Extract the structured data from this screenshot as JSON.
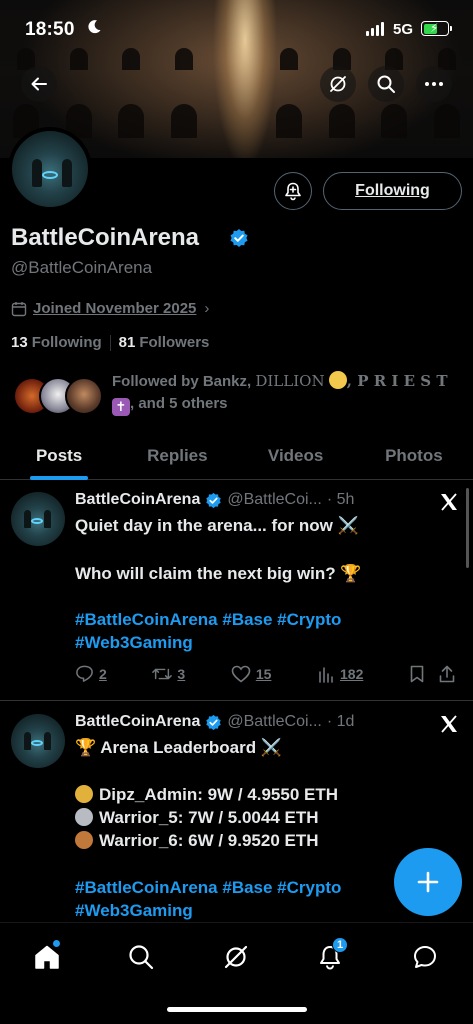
{
  "status_bar": {
    "time": "18:50",
    "network": "5G"
  },
  "profile": {
    "name": "BattleCoinArena",
    "handle": "@BattleCoinArena",
    "joined": "Joined November 2025",
    "following_count": "13",
    "following_label": "Following",
    "followers_count": "81",
    "followers_label": "Followers",
    "follow_button": "Following",
    "followed_by_prefix": "Followed by Bankz, ",
    "followed_by_name2": "DILLION",
    "followed_by_name3": ", P R I E S T",
    "followed_by_suffix": ", and 5 others"
  },
  "tabs": [
    {
      "label": "Posts",
      "active": true
    },
    {
      "label": "Replies",
      "active": false
    },
    {
      "label": "Videos",
      "active": false
    },
    {
      "label": "Photos",
      "active": false
    }
  ],
  "posts": [
    {
      "name": "BattleCoinArena",
      "handle": "@BattleCoi...",
      "time": "· 5h",
      "line1": "Quiet day in the arena... for now ⚔️",
      "line2": "Who will claim the next big win? 🏆",
      "hashtags1": "#BattleCoinArena #Base #Crypto",
      "hashtags2": "#Web3Gaming",
      "replies": "2",
      "reposts": "3",
      "likes": "15",
      "views": "182"
    },
    {
      "name": "BattleCoinArena",
      "handle": "@BattleCoi...",
      "time": "· 1d",
      "line1": "🏆 Arena Leaderboard ⚔️",
      "rank1": "Dipz_Admin: 9W / 4.9550 ETH",
      "rank2": "Warrior_5: 7W / 5.0044 ETH",
      "rank3": "Warrior_6: 6W / 9.9520 ETH",
      "hashtags1": "#BattleCoinArena #Base #Crypto",
      "hashtags2": "#Web3Gaming"
    }
  ],
  "bottom_nav": {
    "notifications_badge": "1"
  },
  "colors": {
    "accent": "#1d9bf0",
    "muted": "#71767b",
    "text": "#e7e9ea",
    "border": "#2f3336"
  }
}
